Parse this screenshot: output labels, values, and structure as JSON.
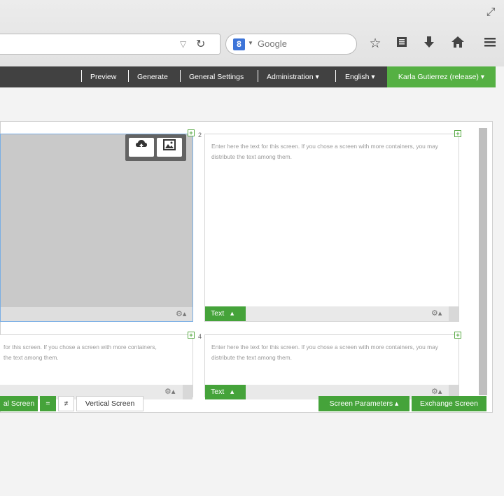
{
  "browser": {
    "search_placeholder": "Google",
    "search_engine_letter": "8"
  },
  "navbar": {
    "items": [
      {
        "label": "Preview"
      },
      {
        "label": "Generate"
      },
      {
        "label": "General Settings"
      },
      {
        "label": "Administration ▾"
      },
      {
        "label": "English ▾"
      }
    ],
    "user": "Karla Gutierrez (release) ▾",
    "accent_color": "#55b043",
    "bar_color": "#414141"
  },
  "containers": {
    "placeholder": "Enter here the text for this screen. If you chose a screen with more containers, you may distribute the text among them.",
    "placeholder_left_line1": "for this screen. If you chose a screen with more containers,",
    "placeholder_left_line2": "the text among them.",
    "number_2": "2",
    "number_4": "4",
    "text_button": "Text",
    "text_button_caret": "▴"
  },
  "bottom_bar": {
    "horizontal_screen": "al Screen",
    "equal_sign": "=",
    "not_equal_sign": "≠",
    "vertical_screen": "Vertical Screen",
    "screen_parameters": "Screen Parameters ▴",
    "exchange_screen": "Exchange Screen"
  },
  "icons": {
    "expand": "expand-icon",
    "upload": "cloud-upload-icon",
    "image": "image-icon"
  }
}
